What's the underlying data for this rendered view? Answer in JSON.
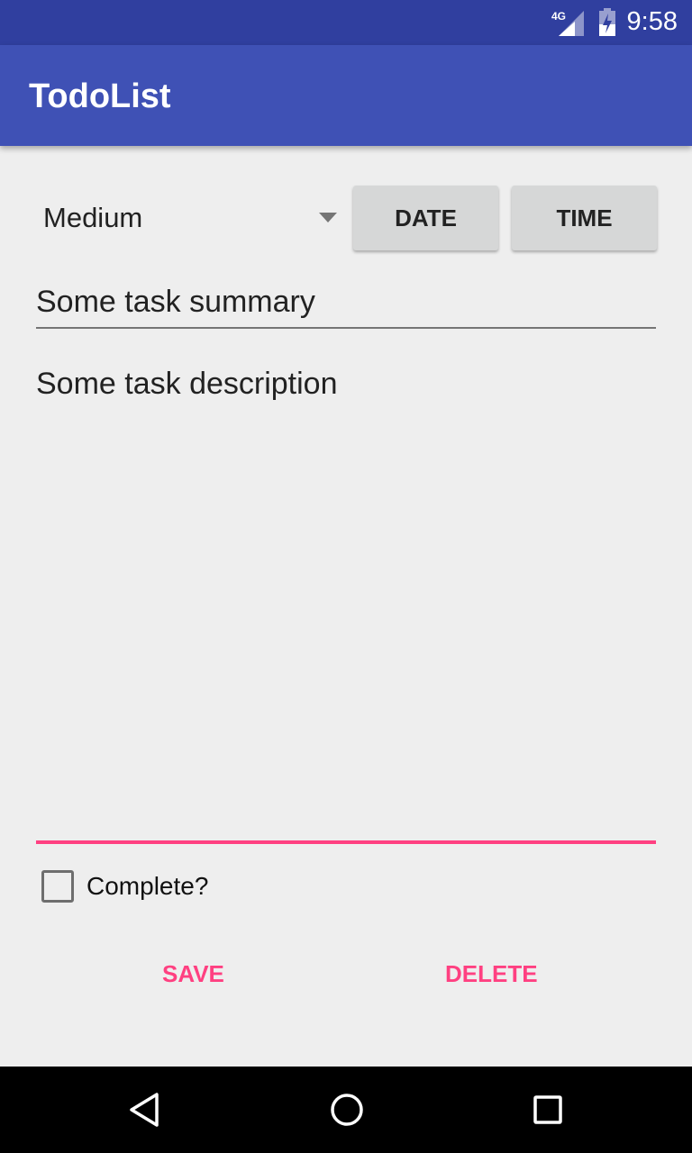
{
  "status_bar": {
    "network": "4G",
    "time": "9:58"
  },
  "app_bar": {
    "title": "TodoList"
  },
  "form": {
    "priority": "Medium",
    "date_label": "DATE",
    "time_label": "TIME",
    "summary": "Some task summary",
    "description": "Some task description",
    "complete_label": "Complete?",
    "complete_checked": false
  },
  "actions": {
    "save": "SAVE",
    "delete": "DELETE"
  },
  "colors": {
    "primary": "#3f51b5",
    "primary_dark": "#303f9f",
    "accent": "#ff4081"
  }
}
